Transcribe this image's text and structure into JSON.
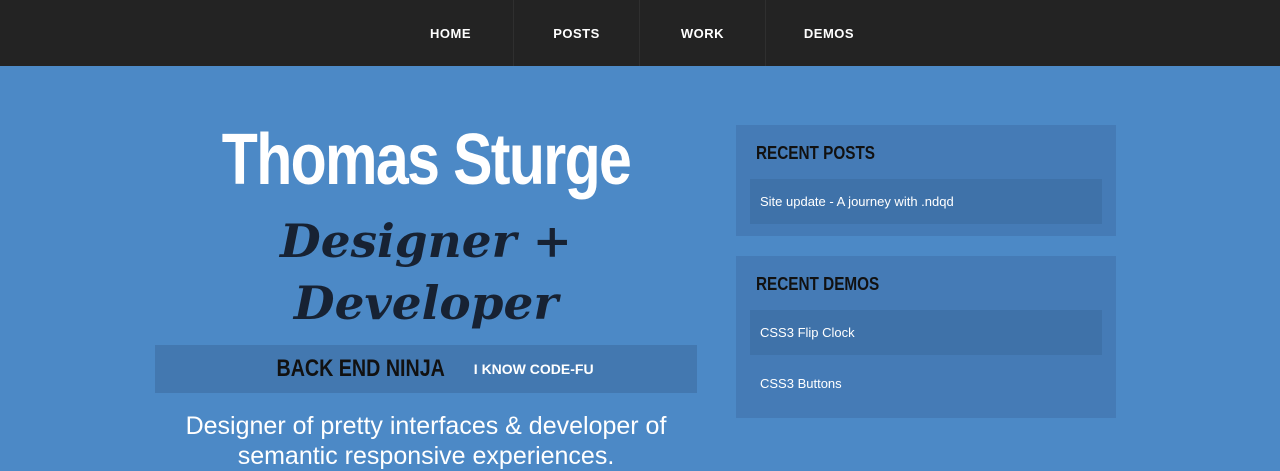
{
  "nav": {
    "items": [
      {
        "label": "HOME"
      },
      {
        "label": "POSTS"
      },
      {
        "label": "WORK"
      },
      {
        "label": "DEMOS"
      }
    ]
  },
  "hero": {
    "name": "Thomas Sturge",
    "role": "Designer + Developer",
    "ninja_label": "BACK END NINJA",
    "ninja_link": "I KNOW CODE-FU",
    "tagline_line1": "Designer of pretty interfaces & developer of",
    "tagline_line2": "semantic responsive experiences."
  },
  "sidebar": {
    "recent_posts": {
      "title": "RECENT POSTS",
      "items": [
        {
          "label": "Site update - A journey with .ndqd"
        }
      ]
    },
    "recent_demos": {
      "title": "RECENT DEMOS",
      "items": [
        {
          "label": "CSS3 Flip Clock"
        },
        {
          "label": "CSS3 Buttons"
        }
      ]
    }
  },
  "colors": {
    "background": "#4c89c6",
    "topbar": "#232323",
    "panel": "#457bb6",
    "panel_item": "#3f72a9"
  }
}
